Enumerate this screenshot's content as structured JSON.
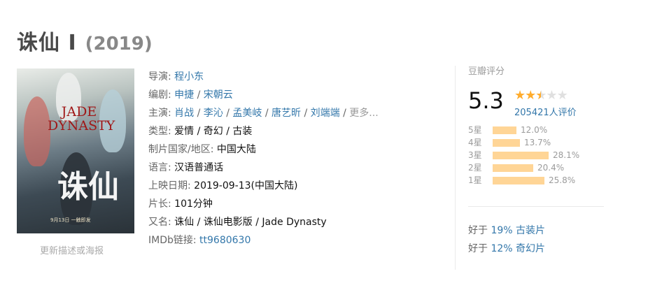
{
  "header": {
    "title": "诛仙 Ⅰ",
    "year": "(2019)"
  },
  "poster": {
    "title": "JADE DYNASTY",
    "calligraphy": "诛仙",
    "date_text": "9月13日 一触即发",
    "update_link": "更新描述或海报"
  },
  "info": {
    "director": {
      "label": "导演:",
      "names": [
        "程小东"
      ]
    },
    "writer": {
      "label": "编剧:",
      "names": [
        "申捷",
        "宋朝云"
      ]
    },
    "cast": {
      "label": "主演:",
      "names": [
        "肖战",
        "李沁",
        "孟美岐",
        "唐艺昕",
        "刘端端"
      ],
      "more": "更多..."
    },
    "genre": {
      "label": "类型:",
      "value": "爱情 / 奇幻 / 古装"
    },
    "region": {
      "label": "制片国家/地区:",
      "value": "中国大陆"
    },
    "language": {
      "label": "语言:",
      "value": "汉语普通话"
    },
    "release": {
      "label": "上映日期:",
      "value": "2019-09-13(中国大陆)"
    },
    "runtime": {
      "label": "片长:",
      "value": "101分钟"
    },
    "aka": {
      "label": "又名:",
      "value": "诛仙 / 诛仙电影版 / Jade Dynasty"
    },
    "imdb": {
      "label": "IMDb链接:",
      "value": "tt9680630"
    },
    "separator": " / "
  },
  "rating": {
    "label": "豆瓣评分",
    "score": "5.3",
    "stars": 2.5,
    "votes": "205421人评价",
    "star_color": "#ffac2d",
    "bar_color": "#ffd596",
    "distribution": [
      {
        "label": "5星",
        "percent": "12.0%",
        "value": 12.0
      },
      {
        "label": "4星",
        "percent": "13.7%",
        "value": 13.7
      },
      {
        "label": "3星",
        "percent": "28.1%",
        "value": 28.1
      },
      {
        "label": "2星",
        "percent": "20.4%",
        "value": 20.4
      },
      {
        "label": "1星",
        "percent": "25.8%",
        "value": 25.8
      }
    ]
  },
  "better_than": [
    {
      "prefix": "好于",
      "link": "19% 古装片"
    },
    {
      "prefix": "好于",
      "link": "12% 奇幻片"
    }
  ],
  "colors": {
    "link": "#37a",
    "label": "#666",
    "muted": "#9b9b9b"
  }
}
